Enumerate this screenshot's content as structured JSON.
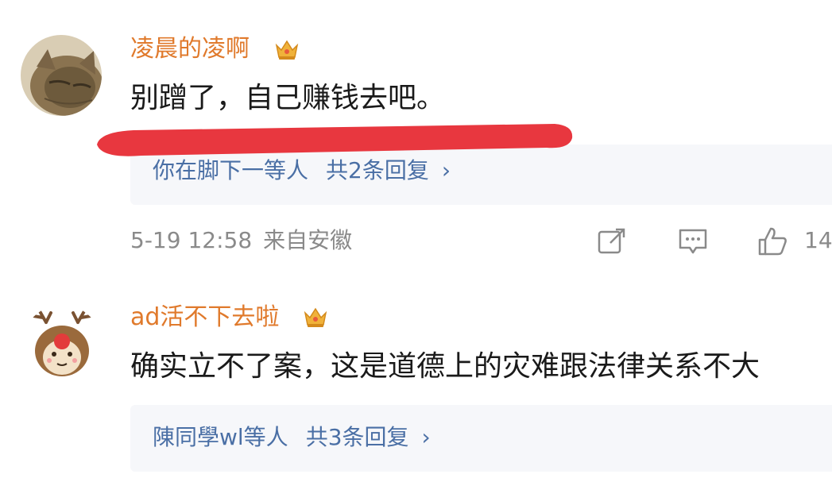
{
  "colors": {
    "username": "#e07a2c",
    "reply_link": "#4a6fa5",
    "annotation_line": "#e8373f",
    "meta_text": "#8a8a8a"
  },
  "comments": [
    {
      "username": "凌晨的凌啊",
      "badge_icon": "crown-icon",
      "text": "别蹭了，自己赚钱去吧。",
      "reply_preview": {
        "users": "你在脚下一等人",
        "count_label": "共2条回复",
        "chevron": "›"
      },
      "time": "5-19 12:58",
      "location": "来自安徽",
      "likes": "14"
    },
    {
      "username": "ad活不下去啦",
      "badge_icon": "crown-icon",
      "text": "确实立不了案，这是道德上的灾难跟法律关系不大",
      "reply_preview": {
        "users": "陳同學wl等人",
        "count_label": "共3条回复",
        "chevron": "›"
      }
    }
  ]
}
